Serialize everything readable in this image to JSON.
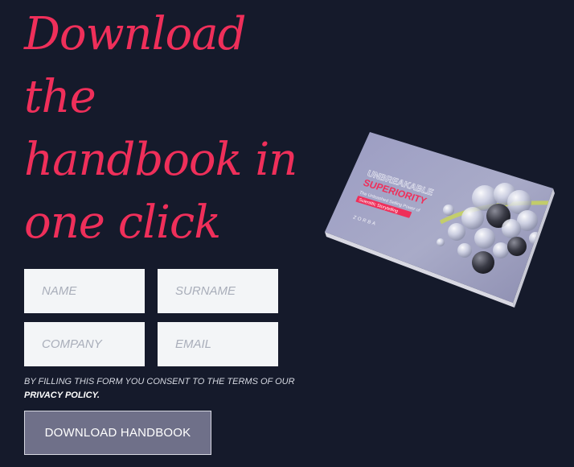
{
  "hero": {
    "headline_lines": [
      "Download",
      "the",
      "handbook in",
      "one click"
    ]
  },
  "form": {
    "fields": {
      "name": {
        "placeholder": "NAME",
        "value": ""
      },
      "surname": {
        "placeholder": "SURNAME",
        "value": ""
      },
      "company": {
        "placeholder": "COMPANY",
        "value": ""
      },
      "email": {
        "placeholder": "EMAIL",
        "value": ""
      }
    },
    "consent_text": "BY FILLING THIS FORM YOU CONSENT TO THE TERMS OF OUR",
    "privacy_link": "PRIVACY POLICY.",
    "submit_label": "DOWNLOAD HANDBOOK"
  },
  "book": {
    "kicker": "UNBREAKABLE",
    "title": "SUPERIORITY",
    "subtitle": "The Unleashed Selling Power of",
    "highlight": "Scientific Storytelling",
    "brand": "ZORBA"
  },
  "colors": {
    "background": "#151a2b",
    "accent": "#ef2f5a",
    "field_bg": "#f3f5f7",
    "button_bg": "#6f7089"
  }
}
